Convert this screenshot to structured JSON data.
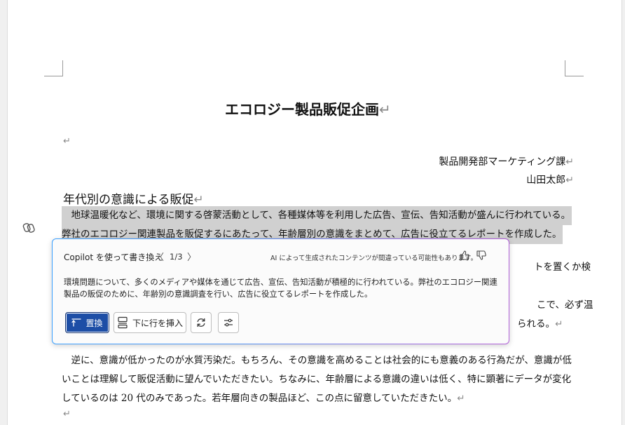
{
  "document": {
    "title": "エコロジー製品販促企画",
    "department": "製品開発部マーケティング課",
    "author": "山田太郎",
    "heading": "年代別の意識による販促",
    "highlighted_lines": [
      "　地球温暖化など、環境に関する啓蒙活動として、各種媒体等を利用した広告、宣伝、告知活動が盛んに行われている。",
      "弊社のエコロジー関連製品を販促するにあたって、年齢層別の意識をまとめて、広告に役立てるレポートを作成した。"
    ],
    "partial_lines": [
      "トを置くか検",
      "こで、必ず温",
      "られる。"
    ],
    "body_lines": [
      "　逆に、意識が低かったのが水質汚染だ。もちろん、その意識を高めることは社会的にも意義のある行為だが、意識が低",
      "いことは理解して販促活動に望んでいただきたい。ちなみに、年齢層による意識の違いは低く、特に顕著にデータが変化",
      "しているのは 20 代のみであった。若年層向きの製品ほど、この点に留意していただきたい。"
    ],
    "paragraph_mark": "↵"
  },
  "copilot": {
    "header": "Copilot を使って書き換え",
    "prev": "〈",
    "next": "〉",
    "counter": "1/3",
    "disclaimer": "AI によって生成されたコンテンツが間違っている可能性もあります。",
    "text": "環境問題について、多くのメディアや媒体を通じて広告、宣伝、告知活動が積極的に行われている。弊社のエコロジー関連製品の販促のために、年齢別の意識調査を行い、広告に役立てるレポートを作成した。",
    "replace_label": "置換",
    "insert_label": "下に行を挿入",
    "icons": {
      "replace": "replace-arrow-icon",
      "insert": "insert-below-icon",
      "regenerate": "regenerate-icon",
      "adjust": "adjust-sliders-icon",
      "like": "thumbs-up-icon",
      "dislike": "thumbs-down-icon",
      "copilot": "copilot-icon"
    },
    "colors": {
      "primary_button": "#1d4ea6",
      "gradient_start": "#3aa0ff",
      "gradient_end": "#b15fd8"
    }
  }
}
